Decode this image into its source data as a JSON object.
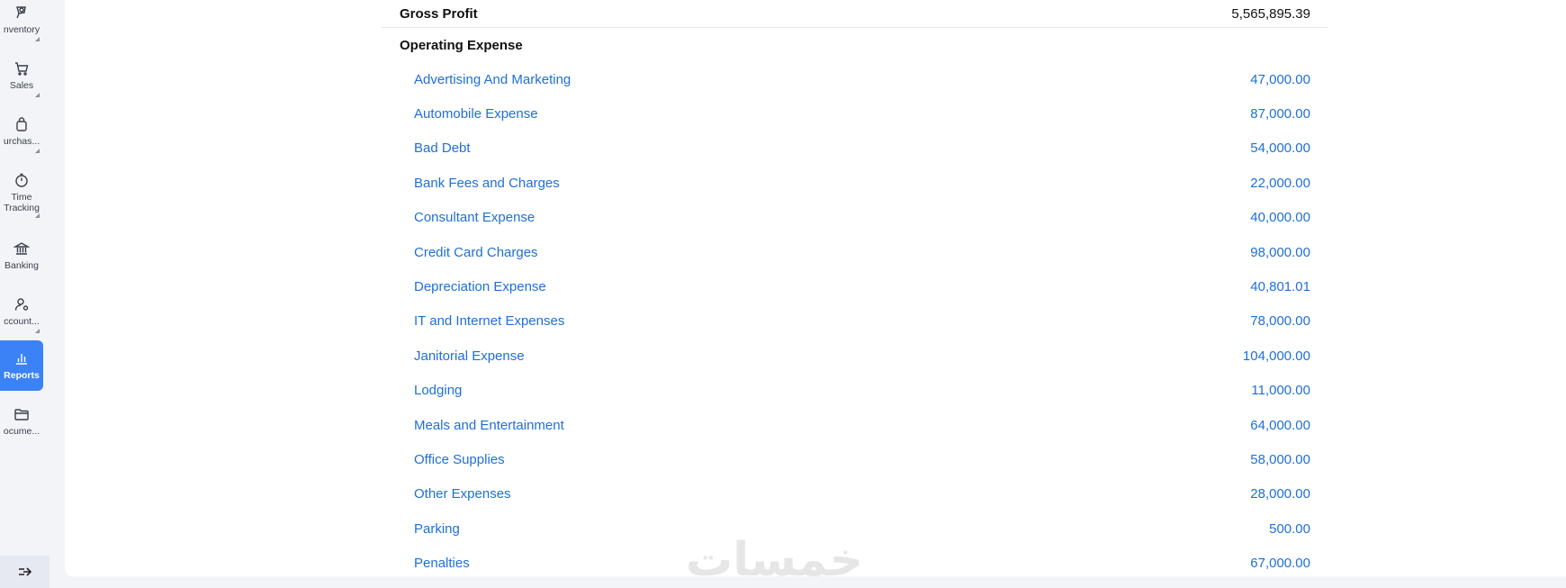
{
  "sidebar": {
    "items": [
      {
        "label": "nventory",
        "icon": "inventory-icon"
      },
      {
        "label": "Sales",
        "icon": "cart-icon"
      },
      {
        "label": "urchas...",
        "icon": "bag-icon"
      },
      {
        "label": "Time\nTracking",
        "label_line1": "Time",
        "label_line2": "Tracking",
        "icon": "stopwatch-icon"
      },
      {
        "label": "Banking",
        "icon": "bank-icon"
      },
      {
        "label": "ccount...",
        "icon": "accountant-icon"
      },
      {
        "label": "Reports",
        "icon": "bar-chart-icon"
      },
      {
        "label": "ocume...",
        "icon": "folder-icon"
      }
    ]
  },
  "report": {
    "gross_profit_label": "Gross Profit",
    "gross_profit_value": "5,565,895.39",
    "operating_expense_label": "Operating Expense",
    "rows": [
      {
        "label": "Advertising And Marketing",
        "value": "47,000.00"
      },
      {
        "label": "Automobile Expense",
        "value": "87,000.00"
      },
      {
        "label": "Bad Debt",
        "value": "54,000.00"
      },
      {
        "label": "Bank Fees and Charges",
        "value": "22,000.00"
      },
      {
        "label": "Consultant Expense",
        "value": "40,000.00"
      },
      {
        "label": "Credit Card Charges",
        "value": "98,000.00"
      },
      {
        "label": "Depreciation Expense",
        "value": "40,801.01"
      },
      {
        "label": "IT and Internet Expenses",
        "value": "78,000.00"
      },
      {
        "label": "Janitorial Expense",
        "value": "104,000.00"
      },
      {
        "label": "Lodging",
        "value": "11,000.00"
      },
      {
        "label": "Meals and Entertainment",
        "value": "64,000.00"
      },
      {
        "label": "Office Supplies",
        "value": "58,000.00"
      },
      {
        "label": "Other Expenses",
        "value": "28,000.00"
      },
      {
        "label": "Parking",
        "value": "500.00"
      },
      {
        "label": "Penalties",
        "value": "67,000.00"
      }
    ]
  },
  "watermark": "خمسات",
  "colors": {
    "accent": "#3b82f6",
    "link": "#1e6fd9"
  }
}
